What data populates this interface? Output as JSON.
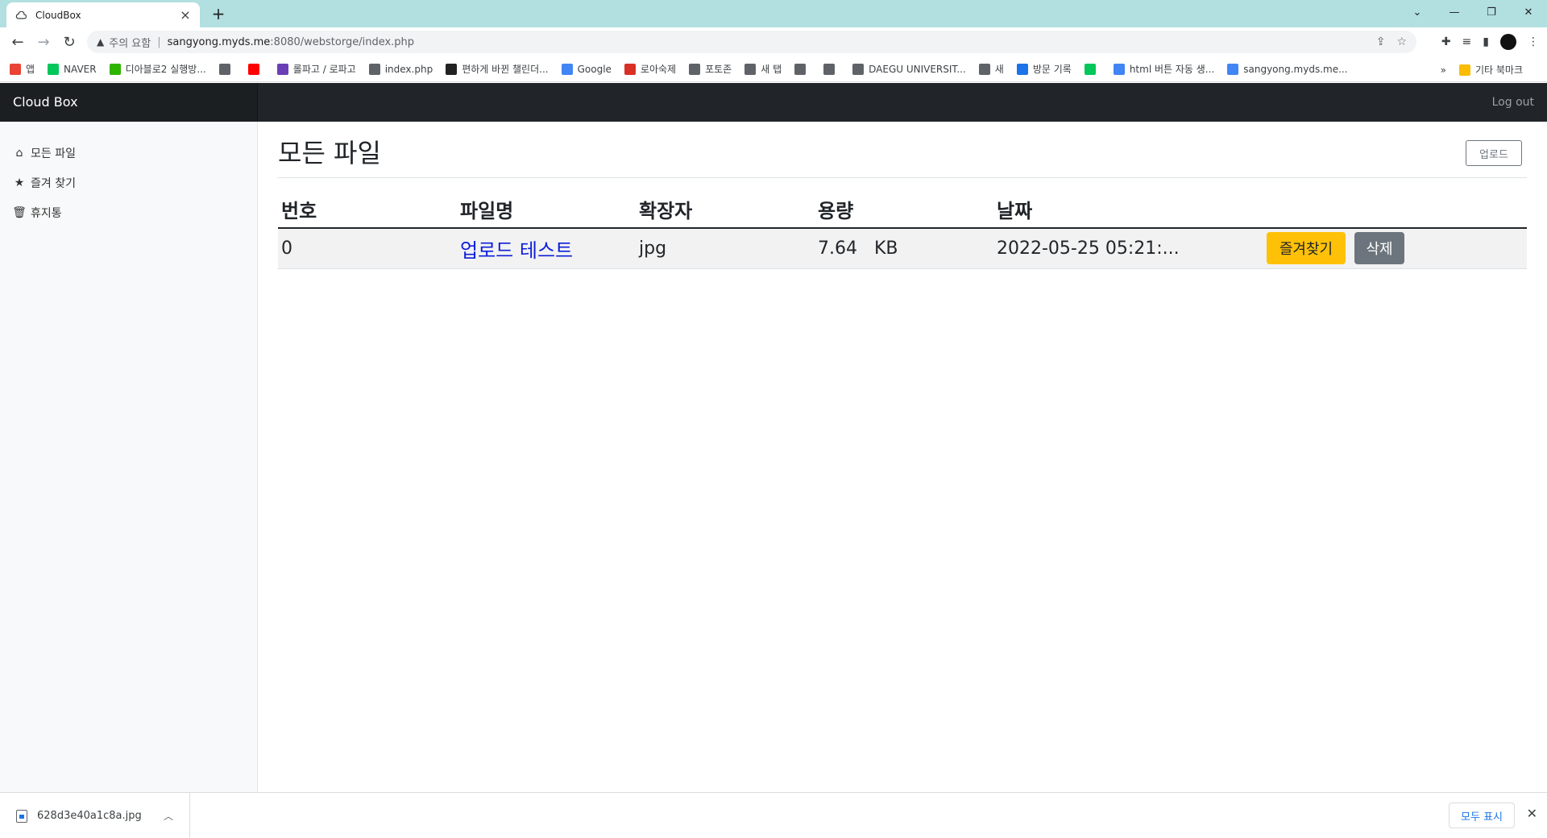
{
  "browser": {
    "tab_title": "CloudBox",
    "address_warning": "주의 요함",
    "address_host": "sangyong.myds.me",
    "address_path": ":8080/webstorge/index.php",
    "bookmarks": [
      {
        "label": "앱",
        "color": "#ea4335"
      },
      {
        "label": "NAVER",
        "color": "#03c75a"
      },
      {
        "label": "디아블로2 실행방...",
        "color": "#2db400"
      },
      {
        "label": "",
        "color": "#5f6368"
      },
      {
        "label": "",
        "color": "#ff0000"
      },
      {
        "label": "롤파고 / 로파고",
        "color": "#6a3fb5"
      },
      {
        "label": "index.php",
        "color": "#5f6368"
      },
      {
        "label": "편하게 바뀐 챌린더...",
        "color": "#222222"
      },
      {
        "label": "Google",
        "color": "#4285f4"
      },
      {
        "label": "로아숙제",
        "color": "#d93025"
      },
      {
        "label": "포토존",
        "color": "#5f6368"
      },
      {
        "label": "새 탭",
        "color": "#5f6368"
      },
      {
        "label": "",
        "color": "#5f6368"
      },
      {
        "label": "",
        "color": "#5f6368"
      },
      {
        "label": "DAEGU UNIVERSIT...",
        "color": "#5f6368"
      },
      {
        "label": "새",
        "color": "#5f6368"
      },
      {
        "label": "방문 기록",
        "color": "#1a73e8"
      },
      {
        "label": "",
        "color": "#03c75a"
      },
      {
        "label": "html 버튼 자동 생...",
        "color": "#4285f4"
      },
      {
        "label": "sangyong.myds.me...",
        "color": "#4285f4"
      }
    ],
    "other_bookmarks": "기타 북마크",
    "overflow": "»"
  },
  "app": {
    "brand": "Cloud Box",
    "logout": "Log out",
    "sidebar": [
      {
        "label": "모든 파일",
        "icon": "home-icon",
        "glyph": "⌂"
      },
      {
        "label": "즐겨 찾기",
        "icon": "star-icon",
        "glyph": "★"
      },
      {
        "label": "휴지통",
        "icon": "trash-icon",
        "glyph": "🗑"
      }
    ],
    "page_title": "모든 파일",
    "upload_label": "업로드",
    "table": {
      "headers": [
        "번호",
        "파일명",
        "확장자",
        "용량",
        "날짜"
      ],
      "rows": [
        {
          "no": "0",
          "name": "업로드 테스트",
          "ext": "jpg",
          "size": "7.64   KB",
          "date": "2022-05-25 05:21:...",
          "fav_label": "즐겨찾기",
          "del_label": "삭제"
        }
      ]
    }
  },
  "downloads": {
    "file_name": "628d3e40a1c8a.jpg",
    "show_all": "모두 표시"
  },
  "colors": {
    "tabstrip": "#b2dfe0",
    "navbar": "#212529",
    "fav_button": "#ffc107",
    "delete_button": "#6c757d",
    "link": "#0d1ed8"
  }
}
